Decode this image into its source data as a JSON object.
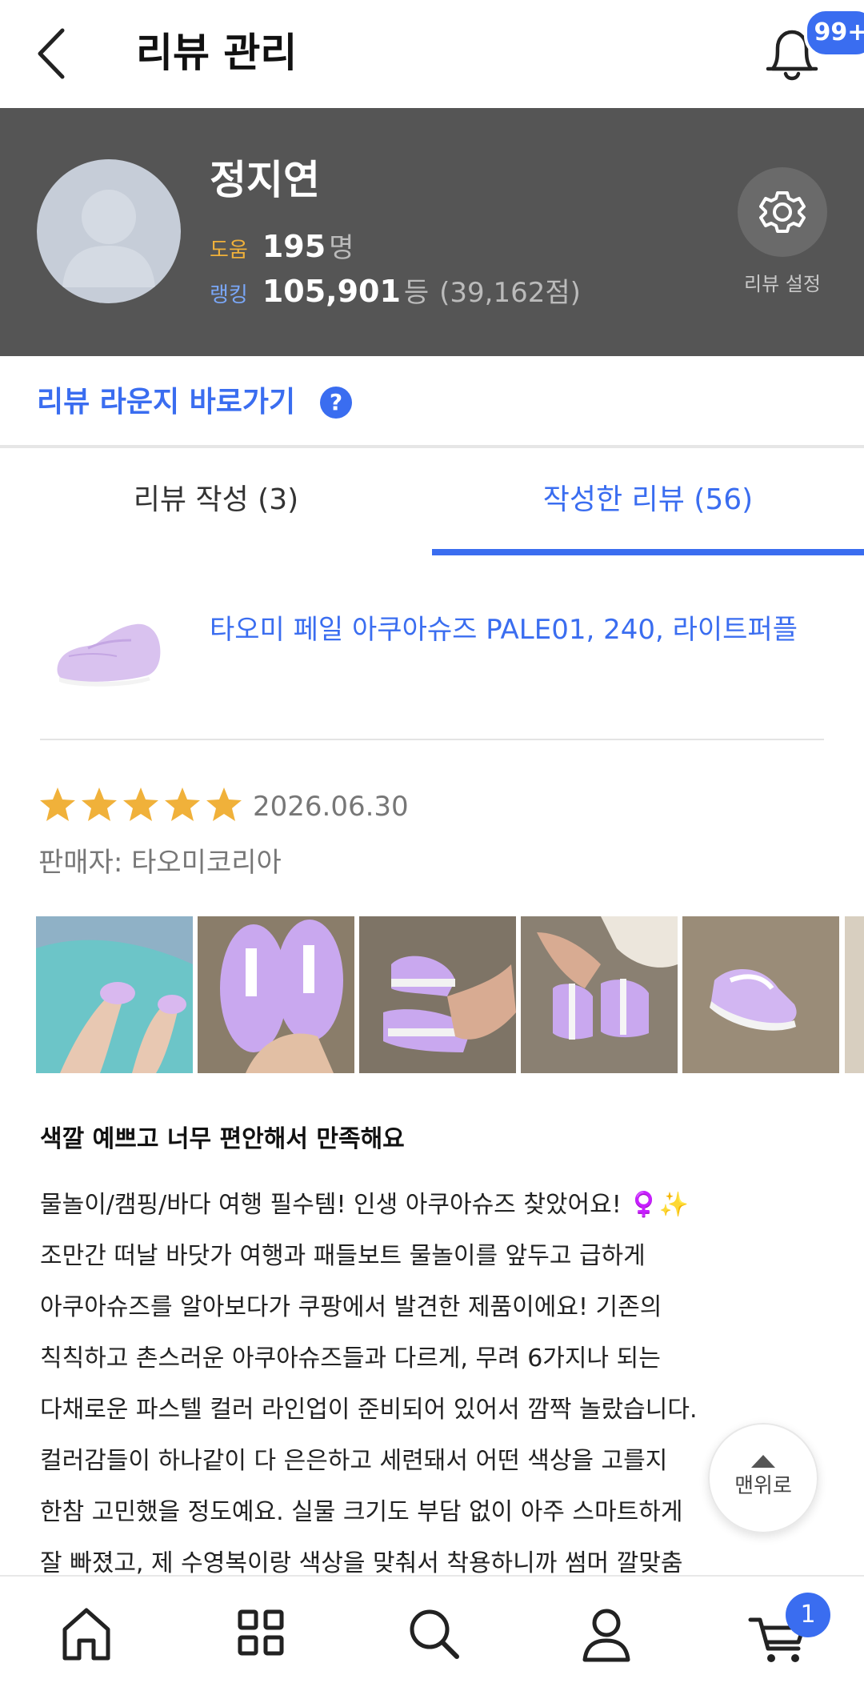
{
  "header": {
    "title": "리뷰 관리",
    "notification_badge": "99+"
  },
  "profile": {
    "name": "정지연",
    "help_label": "도움",
    "help_count": "195",
    "help_unit": "명",
    "rank_label": "랭킹",
    "rank_value": "105,901",
    "rank_unit": "등",
    "rank_points": "(39,162점)",
    "settings_label": "리뷰 설정"
  },
  "lounge": {
    "link_label": "리뷰 라운지 바로가기",
    "help_icon": "?"
  },
  "tabs": [
    {
      "label": "리뷰 작성 (3)",
      "active": false
    },
    {
      "label": "작성한 리뷰 (56)",
      "active": true
    }
  ],
  "review": {
    "product_title": "타오미 페일 아쿠아슈즈 PALE01, 240, 라이트퍼플",
    "rating": 5,
    "date": "2026.06.30",
    "seller": "판매자: 타오미코리아",
    "title": "색깔 예쁘고 너무 편안해서 만족해요",
    "lines": [
      " 물놀이/캠핑/바다 여행 필수템! 인생 아쿠아슈즈 찾았어요! ♀️✨",
      "조만간 떠날 바닷가 여행과 패들보트 물놀이를 앞두고 급하게",
      "아쿠아슈즈를 알아보다가 쿠팡에서 발견한 제품이에요! 기존의",
      "칙칙하고 촌스러운 아쿠아슈즈들과 다르게, 무려 6가지나 되는",
      "다채로운 파스텔 컬러 라인업이 준비되어 있어서 깜짝 놀랐습니다.",
      "컬러감들이 하나같이 다 은은하고 세련돼서 어떤 색상을 고를지",
      "한참 고민했을 정도예요. 실물 크기도 부담 없이 아주 스마트하게",
      "잘 빠졌고, 제 수영복이랑 색상을 맞춰서 착용하니까 썸머 깔맞춤"
    ]
  },
  "scroll_top_label": "맨위로",
  "bottom_nav": {
    "items": [
      "home-icon",
      "category-grid-icon",
      "search-icon",
      "profile-icon",
      "cart-icon"
    ],
    "cart_count": "1"
  },
  "colors": {
    "accent": "#3a6df0",
    "profile_bg": "#555555",
    "star": "#f0b13a"
  }
}
